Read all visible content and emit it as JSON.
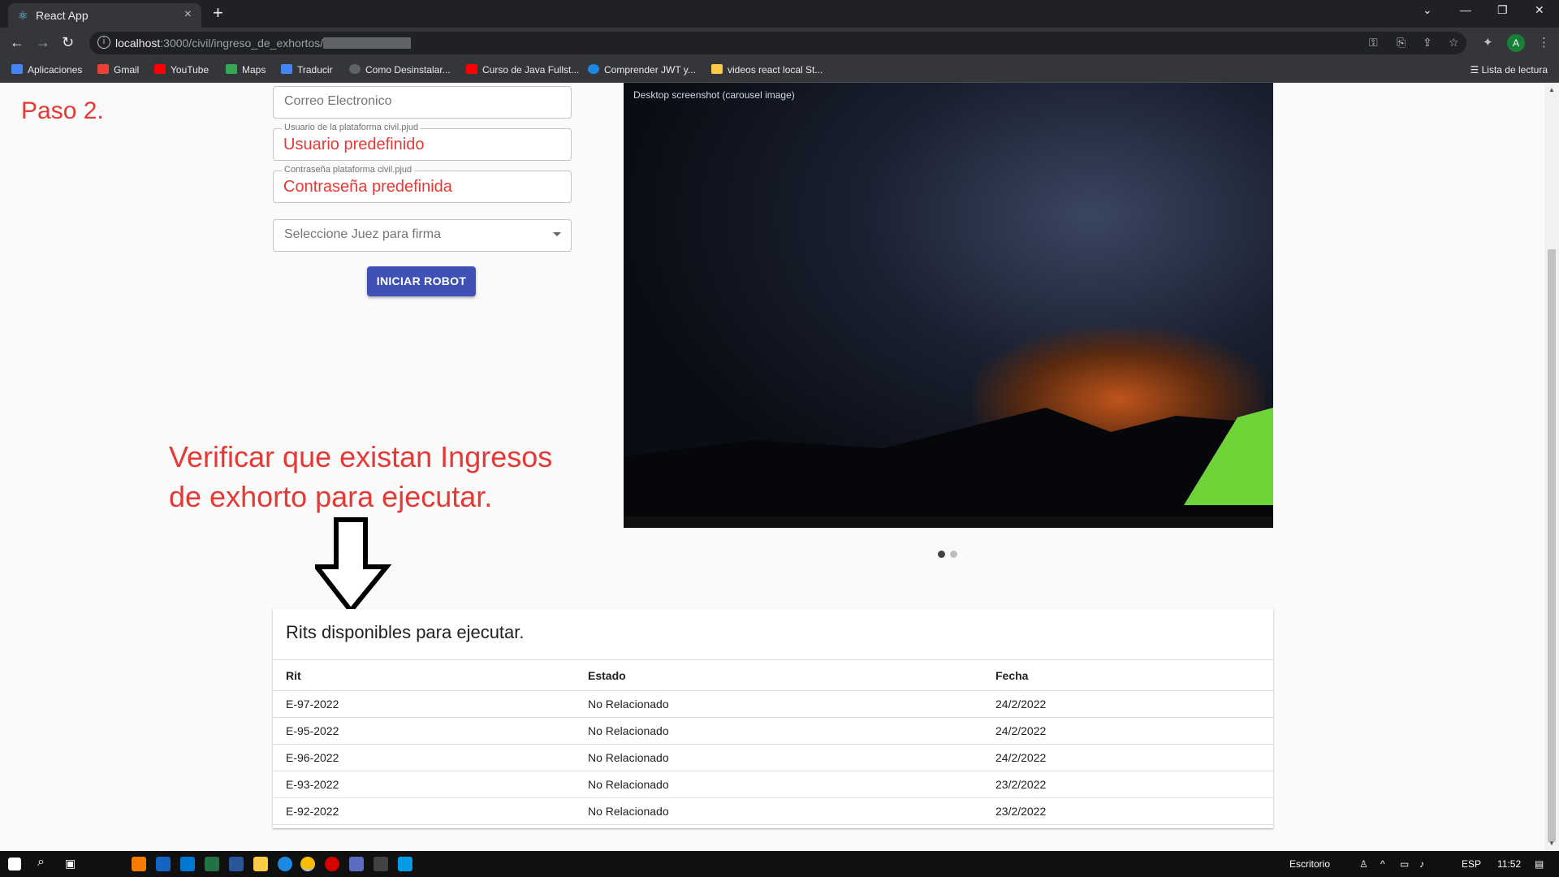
{
  "browser": {
    "tab_title": "React App",
    "url_host": "localhost",
    "url_path": ":3000/civil/ingreso_de_exhortos/",
    "bookmarks": [
      {
        "label": "Aplicaciones",
        "color": "#4285f4"
      },
      {
        "label": "Gmail",
        "color": "#ea4335"
      },
      {
        "label": "YouTube",
        "color": "#ff0000"
      },
      {
        "label": "Maps",
        "color": "#34a853"
      },
      {
        "label": "Traducir",
        "color": "#4285f4"
      },
      {
        "label": "Como Desinstalar...",
        "color": "#5f6368"
      },
      {
        "label": "Curso de Java Fullst...",
        "color": "#ff0000"
      },
      {
        "label": "Comprender JWT y...",
        "color": "#1e88e5"
      },
      {
        "label": "videos react local St...",
        "color": "#f9cb47"
      }
    ],
    "reading_list": "Lista de lectura",
    "profile_initial": "A"
  },
  "annotations": {
    "step": "Paso 2.",
    "verify_line1": "Verificar que existan Ingresos",
    "verify_line2": "de exhorto para ejecutar."
  },
  "form": {
    "email_placeholder": "Correo Electronico",
    "user_label": "Usuario de la plataforma civil.pjud",
    "user_value": "Usuario predefinido",
    "password_label": "Contraseña plataforma civil.pjud",
    "password_value": "Contraseña predefinida",
    "judge_placeholder": "Seleccione Juez para firma",
    "start_button": "INICIAR ROBOT"
  },
  "carousel": {
    "dots_total": 2,
    "active_index": 0,
    "caption": "Desktop screenshot (carousel image)"
  },
  "rits_table": {
    "title": "Rits disponibles para ejecutar.",
    "headers": [
      "Rit",
      "Estado",
      "Fecha"
    ],
    "rows": [
      [
        "E-97-2022",
        "No Relacionado",
        "24/2/2022"
      ],
      [
        "E-95-2022",
        "No Relacionado",
        "24/2/2022"
      ],
      [
        "E-96-2022",
        "No Relacionado",
        "24/2/2022"
      ],
      [
        "E-93-2022",
        "No Relacionado",
        "23/2/2022"
      ],
      [
        "E-92-2022",
        "No Relacionado",
        "23/2/2022"
      ]
    ]
  },
  "taskbar": {
    "desktop_label": "Escritorio",
    "language": "ESP",
    "time": "11:52",
    "apps": [
      {
        "name": "chrome",
        "color": "#fbbc05"
      },
      {
        "name": "vscode",
        "color": "#0078d4"
      },
      {
        "name": "excel",
        "color": "#217346"
      },
      {
        "name": "word",
        "color": "#2b579a"
      }
    ]
  },
  "colors": {
    "accent_red": "#e53935",
    "button_blue": "#3f51b5"
  }
}
